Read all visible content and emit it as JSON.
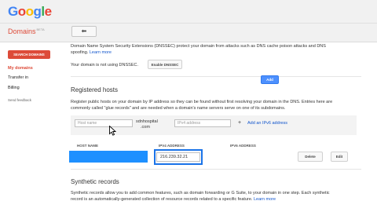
{
  "header": {
    "logo_letters": [
      {
        "ch": "G",
        "color": "#4285f4"
      },
      {
        "ch": "o",
        "color": "#ea4335"
      },
      {
        "ch": "o",
        "color": "#fbbc05"
      },
      {
        "ch": "g",
        "color": "#4285f4"
      },
      {
        "ch": "l",
        "color": "#34a853"
      },
      {
        "ch": "e",
        "color": "#ea4335"
      }
    ],
    "product_name": "Domains",
    "product_badge": "BETA",
    "back_icon": "arrow-left-icon",
    "back_glyph": "⬅"
  },
  "sidebar": {
    "search_button": "SEARCH DOMAINS",
    "items": [
      {
        "label": "My domains",
        "active": true
      },
      {
        "label": "Transfer in",
        "active": false
      },
      {
        "label": "Billing",
        "active": false
      }
    ],
    "feedback": "Send feedback"
  },
  "dnssec": {
    "desc_line1": "Domain Name System Security Extensions (DNSSEC) protect your domain from attacks such as DNS cache poison attacks and DNS",
    "desc_line2_prefix": "spoofing. ",
    "learn_more": "Learn more",
    "status": "Your domain is not using DNSSEC.",
    "enable_button": "Enable DNSSEC"
  },
  "registered_hosts": {
    "title": "Registered hosts",
    "desc_line1": "Register public hosts on your domain by IP address so they can be found without first resolving your domain in the DNS. Entries here are",
    "desc_line2": "commonly called \"glue records\" and are needed when a domain's name servers serve on one of its subdomains.",
    "host_placeholder": "Host name",
    "domain_suffix_line1": "sdnhospital",
    "domain_suffix_line2": ".com",
    "ipv4_placeholder": "IPv4 address",
    "plus_sign": "+",
    "add_ipv6_link": "Add an IPv6 address",
    "add_button": "Add",
    "columns": [
      "HOST NAME",
      "IPV4 ADDRESS",
      "IPV6 ADDRESS"
    ],
    "row": {
      "ipv4": "216.239.32.21",
      "delete_button": "Delete",
      "edit_button": "Edit"
    }
  },
  "synthetic_records": {
    "title": "Synthetic records",
    "desc_line1": "Synthetic records allow you to add common features, such as domain forwarding or G Suite, to your domain in one step. Each synthetic",
    "desc_line2_prefix": "record is an automatically-generated collection of resource records related to a specific feature. ",
    "learn_more": "Learn more"
  },
  "colors": {
    "brand_red": "#dd4b39",
    "link_blue": "#1155cc",
    "redaction_blue": "#1e90ff",
    "highlight_blue": "#1a73e8",
    "add_button_blue": "#4d90fe"
  }
}
